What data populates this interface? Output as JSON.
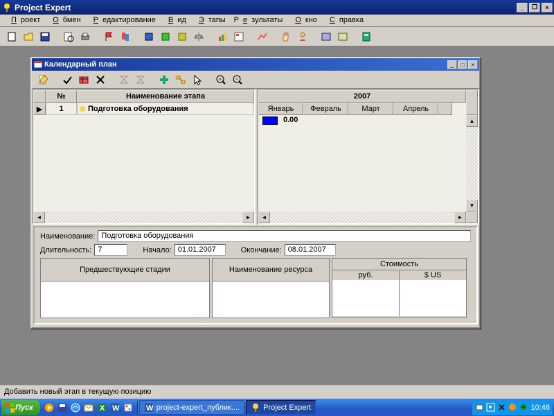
{
  "app": {
    "title": "Project Expert"
  },
  "menu": [
    "Проект",
    "Обмен",
    "Редактирование",
    "Вид",
    "Этапы",
    "Результаты",
    "Окно",
    "Справка"
  ],
  "child": {
    "title": "Календарный план",
    "grid": {
      "col_num": "№",
      "col_name": "Наименование этапа",
      "rows": [
        {
          "num": "1",
          "name": "Подготовка оборудования"
        }
      ]
    },
    "timeline": {
      "year": "2007",
      "months": [
        "Январь",
        "Февраль",
        "Март",
        "Апрель"
      ],
      "bar_value": "0.00"
    },
    "details": {
      "label_name": "Наименование:",
      "name": "Подготовка оборудования",
      "label_duration": "Длительность:",
      "duration": "7",
      "label_start": "Начало:",
      "start": "01.01.2007",
      "label_end": "Окончание:",
      "end": "08.01.2007",
      "header_prev": "Предшествующие стадии",
      "header_resource": "Наименование ресурса",
      "header_cost": "Стоимость",
      "cost_sub1": "руб.",
      "cost_sub2": "$ US"
    }
  },
  "status": "Добавить новый этап в текущую позицию",
  "taskbar": {
    "start": "Пуск",
    "tasks": [
      {
        "label": "project-expert_публик....",
        "active": false
      },
      {
        "label": "Project Expert",
        "active": true
      }
    ],
    "time": "10:46"
  }
}
